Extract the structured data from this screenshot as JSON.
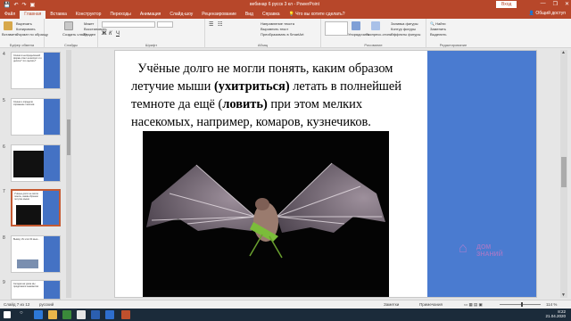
{
  "titlebar": {
    "title": "вебинар 6 русск 3 кл - PowerPoint",
    "signin": "Вход",
    "qa_icons": [
      "save-icon",
      "undo-icon",
      "redo-icon",
      "present-icon"
    ],
    "window_controls": [
      "—",
      "❐",
      "✕"
    ]
  },
  "tabs": [
    {
      "label": "Файл",
      "active": false
    },
    {
      "label": "Главная",
      "active": true
    },
    {
      "label": "Вставка",
      "active": false
    },
    {
      "label": "Конструктор",
      "active": false
    },
    {
      "label": "Переходы",
      "active": false
    },
    {
      "label": "Анимация",
      "active": false
    },
    {
      "label": "Слайд-шоу",
      "active": false
    },
    {
      "label": "Рецензирование",
      "active": false
    },
    {
      "label": "Вид",
      "active": false
    },
    {
      "label": "Справка",
      "active": false
    }
  ],
  "tell_me": "Что вы хотите сделать?",
  "share": "Общий доступ",
  "ribbon": {
    "clipboard": {
      "label": "Буфер обмена",
      "paste": "Вставить",
      "cut": "Вырезать",
      "copy": "Копировать",
      "format": "Формат по образцу"
    },
    "slides": {
      "label": "Слайды",
      "new_slide": "Создать слайд",
      "layout": "Макет",
      "reset": "Восстановить",
      "section": "Раздел"
    },
    "font": {
      "label": "Шрифт"
    },
    "paragraph": {
      "label": "Абзац",
      "direction": "Направление текста",
      "align": "Выровнять текст",
      "smartart": "Преобразовать в SmartArt"
    },
    "drawing": {
      "label": "Рисование",
      "arrange": "Упорядочить",
      "styles": "Экспресс-стили",
      "fill": "Заливка фигуры",
      "outline": "Контур фигуры",
      "effects": "Эффекты фигуры"
    },
    "editing": {
      "label": "Редактирование",
      "find": "Найти",
      "replace": "Заменить",
      "select": "Выделить"
    }
  },
  "slides_panel": [
    {
      "num": "4",
      "selected": false,
      "text": "Спиши в неопределённой форме ответ на вопрос что делать? что сделать?"
    },
    {
      "num": "5",
      "selected": false,
      "text": "Спиши и определи спряжение глаголов"
    },
    {
      "num": "6",
      "selected": false,
      "text": ""
    },
    {
      "num": "7",
      "selected": true,
      "text": "Учёные долго не могли понять, каким образом летучие мыши"
    },
    {
      "num": "8",
      "selected": false,
      "text": "Вывод: Из этих 32 мыш..."
    },
    {
      "num": "9",
      "selected": false,
      "text": "Сегодня на уроке мы продолжили знакомство"
    }
  ],
  "slide": {
    "line1": "Учёные долго не могли понять, каким образом",
    "line2a": "летучие мыши ",
    "line2b": "(ухитриться)",
    "line2c": " летать в полнейшей",
    "line3a": "темноте да ещё (",
    "line3b": "ловить)",
    "line3c": " при этом мелких",
    "line4": "насекомых, например, комаров, кузнечиков.",
    "watermark1": "ДОМ",
    "watermark2": "ЗНАНИЙ"
  },
  "status": {
    "slide_info": "Слайд 7 из 12",
    "language": "русский",
    "notes": "Заметки",
    "comments": "Примечания",
    "zoom": "114 %"
  },
  "taskbar": {
    "time": "8:22",
    "date": "21.04.2020"
  }
}
